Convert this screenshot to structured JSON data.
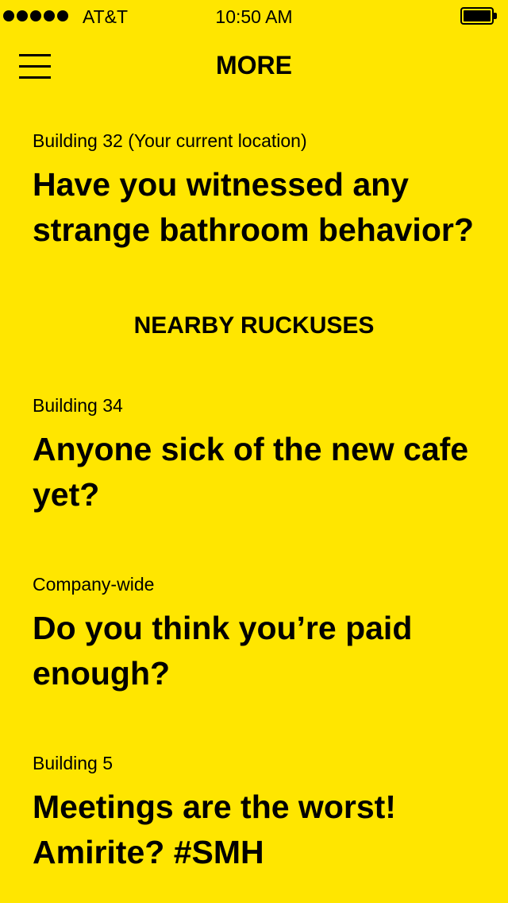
{
  "status_bar": {
    "carrier": "AT&T",
    "time": "10:50 AM",
    "signal_icon": "signal-dots-icon",
    "battery_icon": "battery-icon",
    "battery_level": 1.0
  },
  "nav": {
    "title": "MORE",
    "menu_icon": "hamburger-menu-icon"
  },
  "current_post": {
    "location": "Building 32 (Your current location)",
    "question": "Have you witnessed any strange bathroom behavior?"
  },
  "nearby": {
    "heading": "NEARBY RUCKUSES",
    "posts": [
      {
        "location": "Building 34",
        "question": "Anyone sick of the new cafe yet?"
      },
      {
        "location": "Company-wide",
        "question": "Do you think you’re paid enough?"
      },
      {
        "location": "Building 5",
        "question": "Meetings are the worst! Amirite? #SMH"
      }
    ]
  },
  "colors": {
    "background": "#FFE600",
    "text": "#000000"
  }
}
